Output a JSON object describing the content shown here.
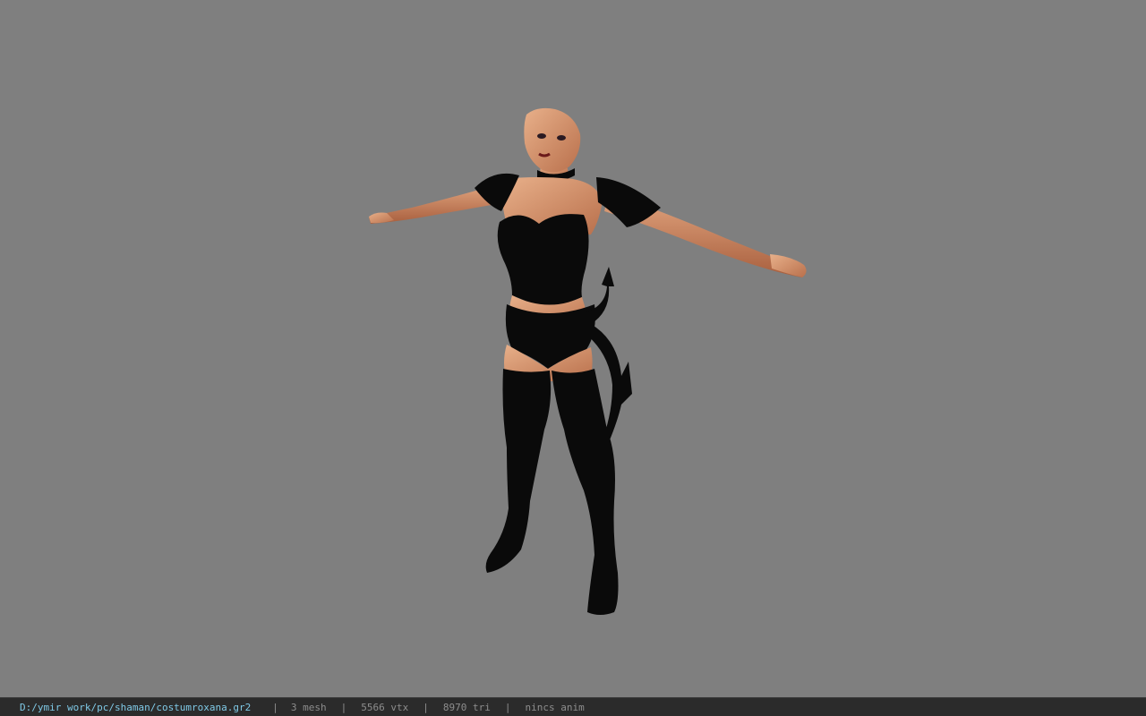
{
  "viewer": {
    "file_path": "D:/ymir work/pc/shaman/costumroxana.gr2",
    "separator": "|",
    "mesh_count": "3 mesh",
    "vertex_count": "5566 vtx",
    "triangle_count": "8970 tri",
    "animation": "nincs anim"
  },
  "colors": {
    "background": "#7f7f7f",
    "status_bar": "#2b2b2b",
    "path_text": "#7fc9e6",
    "status_text": "#8d8d8d",
    "skin": "#d99a73",
    "costume": "#0a0a0a"
  }
}
